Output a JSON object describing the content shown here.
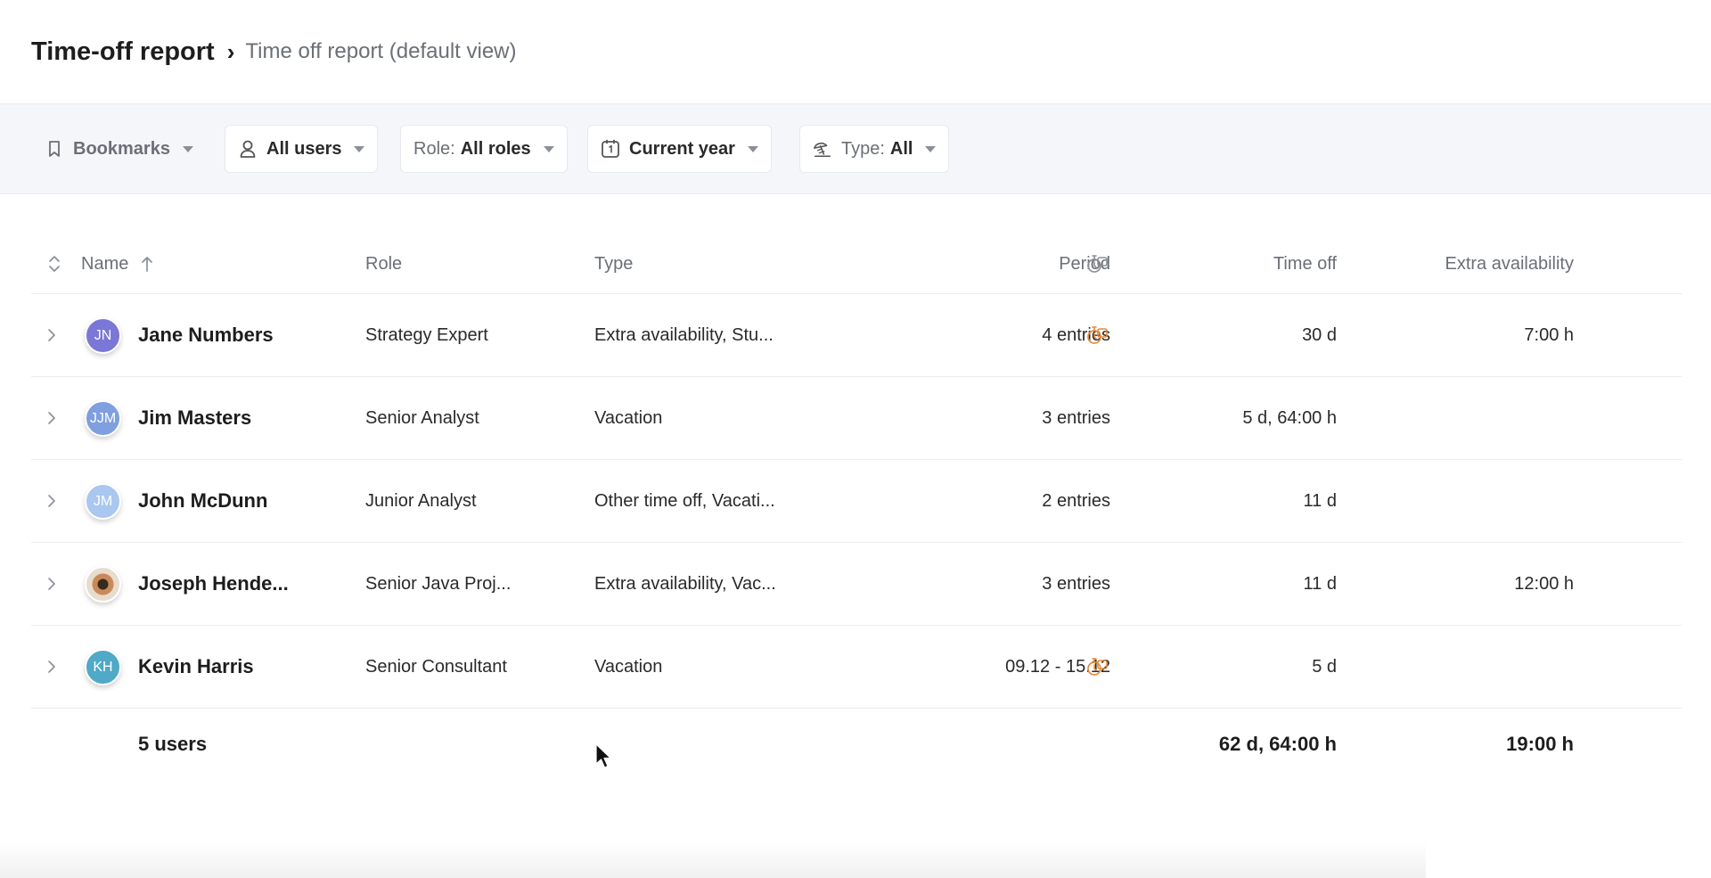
{
  "header": {
    "title": "Time-off report",
    "separator": "›",
    "subtitle": "Time off report (default view)"
  },
  "filters": {
    "bookmarks": {
      "label": "Bookmarks",
      "icon": "bookmark-icon"
    },
    "users": {
      "value": "All users",
      "icon": "user-icon"
    },
    "role": {
      "prefix": "Role:",
      "value": "All roles"
    },
    "period": {
      "value": "Current year",
      "icon": "calendar-icon"
    },
    "type": {
      "prefix": "Type:",
      "value": "All",
      "icon": "beach-umbrella-icon"
    }
  },
  "table": {
    "columns": {
      "name": "Name",
      "role": "Role",
      "type": "Type",
      "period": "Period",
      "icon": "stopwatch-icon",
      "time_off": "Time off",
      "extra": "Extra availability"
    },
    "rows": [
      {
        "initials": "JN",
        "name": "Jane Numbers",
        "role": "Strategy Expert",
        "type": "Extra availability, Stu...",
        "period": "4 entries",
        "timer": true,
        "time_off": "30 d",
        "extra": "7:00 h"
      },
      {
        "initials": "JJM",
        "name": "Jim Masters",
        "role": "Senior Analyst",
        "type": "Vacation",
        "period": "3 entries",
        "timer": false,
        "time_off": "5 d, 64:00 h",
        "extra": ""
      },
      {
        "initials": "JM",
        "name": "John McDunn",
        "role": "Junior Analyst",
        "type": "Other time off, Vacati...",
        "period": "2 entries",
        "timer": false,
        "time_off": "11 d",
        "extra": ""
      },
      {
        "initials": "",
        "name": "Joseph Hende...",
        "role": "Senior Java Proj...",
        "type": "Extra availability, Vac...",
        "period": "3 entries",
        "timer": false,
        "time_off": "11 d",
        "extra": "12:00 h"
      },
      {
        "initials": "KH",
        "name": "Kevin Harris",
        "role": "Senior Consultant",
        "type": "Vacation",
        "period": "09.12 - 15.12",
        "timer": true,
        "time_off": "5 d",
        "extra": ""
      }
    ],
    "footer": {
      "count": "5 users",
      "time_off_total": "62 d, 64:00 h",
      "extra_total": "19:00 h"
    }
  },
  "colors": {
    "accent_orange": "#e08a3c",
    "filter_bar_bg": "#f4f6fa"
  }
}
